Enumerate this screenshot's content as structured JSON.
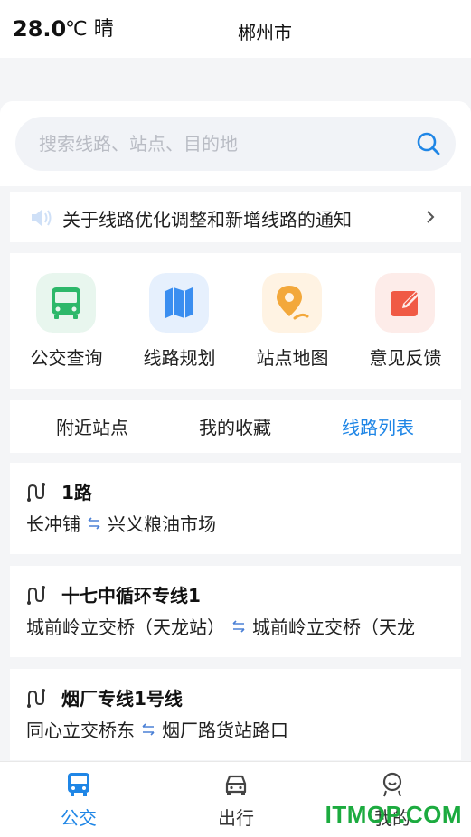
{
  "status": {
    "temperature": "28.0",
    "unit_weather": "℃ 晴",
    "city": "郴州市"
  },
  "search": {
    "placeholder": "搜索线路、站点、目的地"
  },
  "notice": {
    "text": "关于线路优化调整和新增线路的通知"
  },
  "quick_actions": [
    {
      "label": "公交查询",
      "icon": "bus-icon",
      "bg": "#e8f6ee",
      "fg": "#2db86a"
    },
    {
      "label": "线路规划",
      "icon": "map-icon",
      "bg": "#e6f0fd",
      "fg": "#3a8ef0"
    },
    {
      "label": "站点地图",
      "icon": "location-pin-icon",
      "bg": "#fff3e3",
      "fg": "#f3a83b"
    },
    {
      "label": "意见反馈",
      "icon": "feedback-edit-icon",
      "bg": "#fdece9",
      "fg": "#f05a45"
    }
  ],
  "tabs": [
    {
      "label": "附近站点"
    },
    {
      "label": "我的收藏"
    },
    {
      "label": "线路列表",
      "active": true
    }
  ],
  "routes": [
    {
      "name": "1路",
      "from": "长冲铺",
      "to": "兴义粮油市场"
    },
    {
      "name": "十七中循环专线1",
      "from": "城前岭立交桥（天龙站）",
      "to": "城前岭立交桥（天龙"
    },
    {
      "name": "烟厂专线1号线",
      "from": "同心立交桥东",
      "to": "烟厂路货站路口"
    }
  ],
  "bottom_nav": [
    {
      "label": "公交",
      "active": true
    },
    {
      "label": "出行"
    },
    {
      "label": "我的"
    }
  ],
  "watermark": "ITMOP.COM",
  "colors": {
    "accent": "#1f86e6",
    "watermark": "#1cab3f"
  }
}
